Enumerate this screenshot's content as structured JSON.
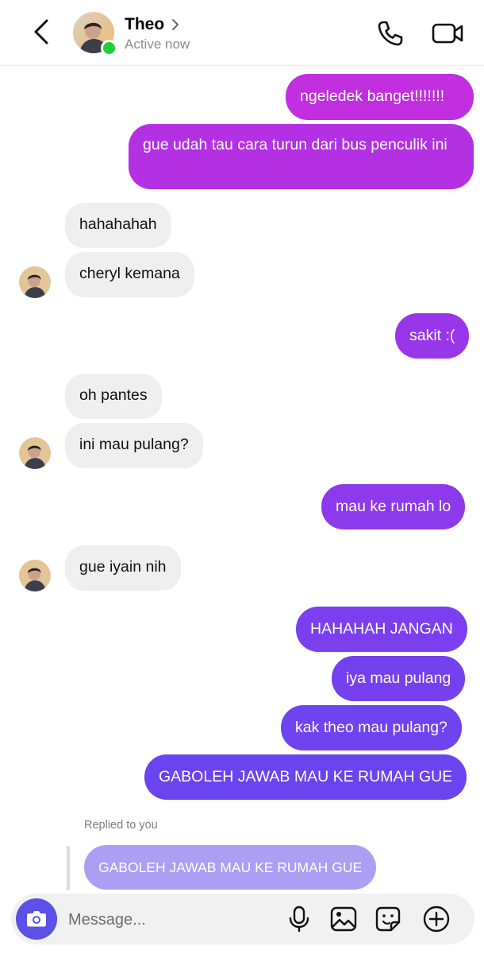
{
  "header": {
    "contact_name": "Theo",
    "status": "Active now",
    "icons": [
      "back-arrow-icon",
      "chevron-right-icon",
      "phone-icon",
      "video-camera-icon"
    ]
  },
  "messages": [
    {
      "side": "out",
      "text": "ngeledek banget!!!!!!!"
    },
    {
      "side": "out",
      "text": "gue udah tau cara turun dari bus penculik ini"
    },
    {
      "side": "in",
      "text": "hahahahah"
    },
    {
      "side": "in",
      "text": "cheryl kemana"
    },
    {
      "side": "out",
      "text": "sakit :("
    },
    {
      "side": "in",
      "text": "oh pantes"
    },
    {
      "side": "in",
      "text": "ini mau pulang?"
    },
    {
      "side": "out",
      "text": "mau ke rumah lo"
    },
    {
      "side": "in",
      "text": "gue iyain nih"
    },
    {
      "side": "out",
      "text": "HAHAHAH JANGAN"
    },
    {
      "side": "out",
      "text": "iya mau pulang"
    },
    {
      "side": "out",
      "text": "kak theo mau pulang?"
    },
    {
      "side": "out",
      "text": "GABOLEH JAWAB MAU KE RUMAH GUE"
    }
  ],
  "reply": {
    "label": "Replied to you",
    "quoted_text": "GABOLEH JAWAB MAU KE RUMAH GUE"
  },
  "composer": {
    "placeholder": "Message...",
    "icons": [
      "camera-icon",
      "microphone-icon",
      "gallery-icon",
      "sticker-icon",
      "plus-circle-icon"
    ]
  },
  "colors": {
    "gradient_top": "#c12fe0",
    "gradient_mid": "#8a3ef0",
    "gradient_bottom": "#6a44ef",
    "incoming_bubble": "#efefef",
    "reply_bubble": "#ab9ff4",
    "online_dot": "#1fcf3a",
    "camera_button": "#5b51e6"
  }
}
